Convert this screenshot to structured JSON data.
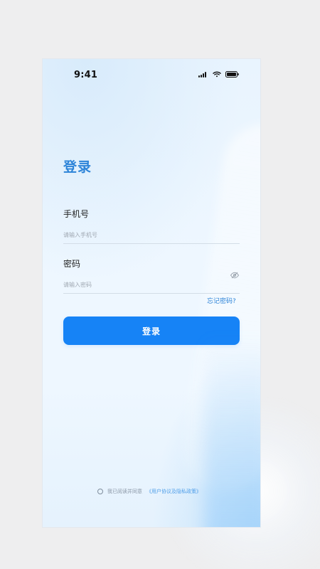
{
  "status_bar": {
    "time": "9:41",
    "icons": [
      "signal-icon",
      "wifi-icon",
      "battery-icon"
    ]
  },
  "login": {
    "title": "登录",
    "phone_label": "手机号",
    "phone_placeholder": "请输入手机号",
    "password_label": "密码",
    "password_placeholder": "请输入密码",
    "forgot_text": "忘记密码?",
    "submit_label": "登录"
  },
  "agreement": {
    "prefix": "我已阅读并同意",
    "link_text": "《用户协议及隐私政策》"
  },
  "colors": {
    "accent": "#1683f6",
    "title": "#2d84d8",
    "text": "#222222",
    "muted": "#8a96a6"
  }
}
